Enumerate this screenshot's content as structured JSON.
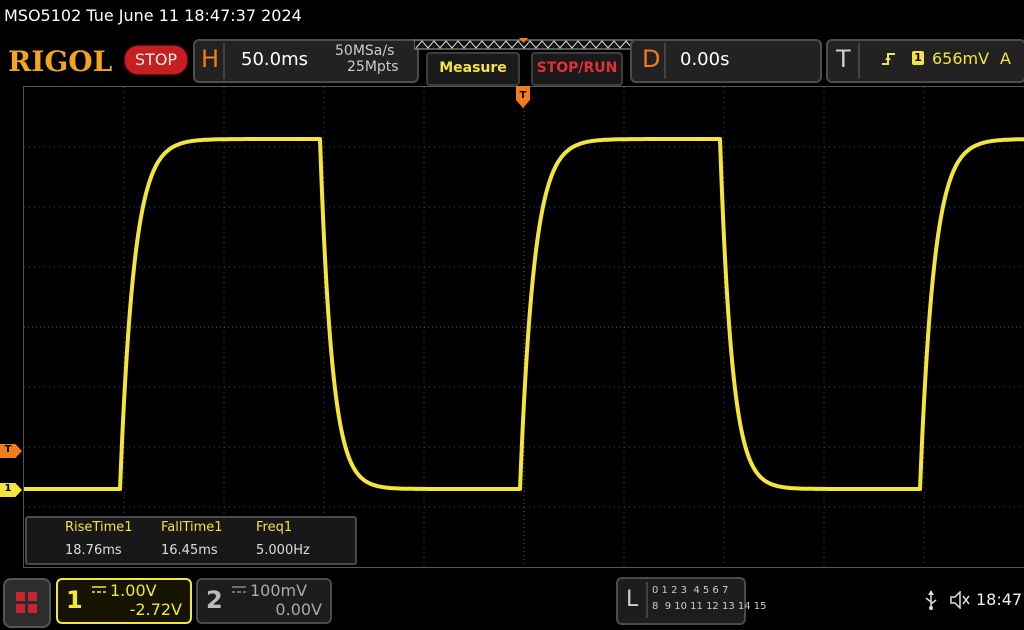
{
  "window": {
    "title": "MSO5102  Tue June 11 18:47:37 2024"
  },
  "brand": {
    "logo": "RIGOL",
    "run_state": "STOP"
  },
  "horizontal": {
    "letter": "H",
    "timebase": "50.0ms",
    "sample_rate": "50MSa/s",
    "memory_depth": "25Mpts"
  },
  "buttons": {
    "measure": "Measure",
    "stop_run": "STOP/RUN"
  },
  "delay": {
    "letter": "D",
    "value": "0.00s"
  },
  "trigger": {
    "letter": "T",
    "channel": "1",
    "level": "656mV",
    "mode": "A",
    "edge_icon": "rising-edge-icon"
  },
  "markers": {
    "trigger": "T",
    "channel1": "1"
  },
  "measurements": [
    {
      "name": "RiseTime1",
      "value": "18.76ms"
    },
    {
      "name": "FallTime1",
      "value": "16.45ms"
    },
    {
      "name": "Freq1",
      "value": "5.000Hz"
    }
  ],
  "channels": [
    {
      "number": "1",
      "scale": "1.00V",
      "offset": "-2.72V",
      "coupling_icon": "dc-coupling-icon"
    },
    {
      "number": "2",
      "scale": "100mV",
      "offset": "0.00V",
      "coupling_icon": "dc-coupling-icon"
    }
  ],
  "logic": {
    "letter": "L",
    "row1": "0 1 2 3  4 5 6 7",
    "row2": "8  9 10 11 12 13 14 15"
  },
  "status": {
    "time": "18:47"
  },
  "colors": {
    "channel1": "#f3e53b",
    "brand": "#f3a51d",
    "trigger": "#f07d1a",
    "stop": "#c61f1f"
  }
}
